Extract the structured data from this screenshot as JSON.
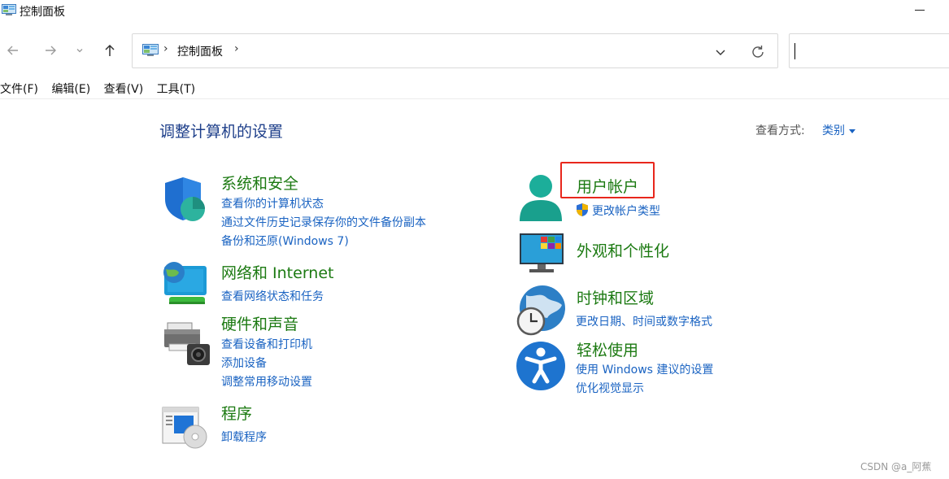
{
  "window": {
    "title": "控制面板"
  },
  "address": {
    "separator": "›",
    "path": "控制面板",
    "trail": "›"
  },
  "menu": {
    "file": "文件(F)",
    "edit": "编辑(E)",
    "view": "查看(V)",
    "tools": "工具(T)"
  },
  "main": {
    "heading": "调整计算机的设置",
    "view_by_label": "查看方式:",
    "view_by_value": "类别"
  },
  "categories": {
    "system_security": {
      "title": "系统和安全",
      "links": [
        "查看你的计算机状态",
        "通过文件历史记录保存你的文件备份副本",
        "备份和还原(Windows 7)"
      ]
    },
    "network": {
      "title": "网络和 Internet",
      "links": [
        "查看网络状态和任务"
      ]
    },
    "hardware": {
      "title": "硬件和声音",
      "links": [
        "查看设备和打印机",
        "添加设备",
        "调整常用移动设置"
      ]
    },
    "programs": {
      "title": "程序",
      "links": [
        "卸载程序"
      ]
    },
    "user_accounts": {
      "title": "用户帐户",
      "links": [
        "更改帐户类型"
      ]
    },
    "appearance": {
      "title": "外观和个性化"
    },
    "clock_region": {
      "title": "时钟和区域",
      "links": [
        "更改日期、时间或数字格式"
      ]
    },
    "ease_access": {
      "title": "轻松使用",
      "links": [
        "使用 Windows 建议的设置",
        "优化视觉显示"
      ]
    }
  },
  "watermark": "CSDN @a_阿蕉",
  "colors": {
    "heading": "#1e3f8a",
    "category": "#1c7a12",
    "link": "#1a63c2",
    "highlight": "#e8271c"
  }
}
